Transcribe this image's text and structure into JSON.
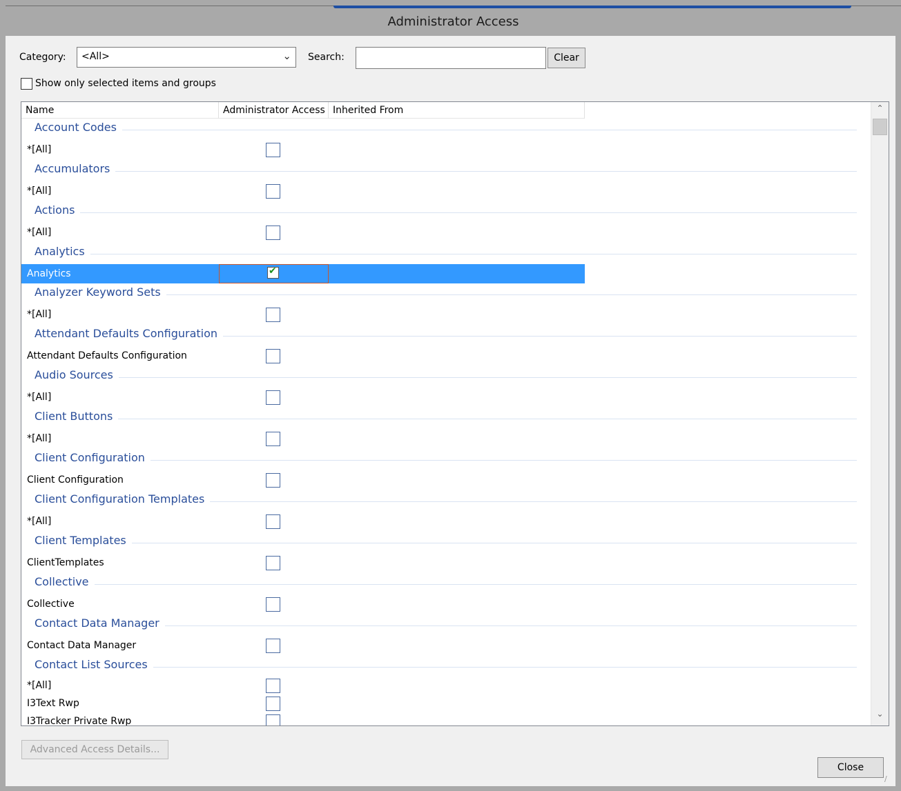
{
  "window": {
    "title": "Administrator Access"
  },
  "filters": {
    "category_label": "Category:",
    "category_value": "<All>",
    "search_label": "Search:",
    "search_value": "",
    "clear_label": "Clear",
    "show_selected_label": "Show only selected items and groups",
    "show_selected_checked": false
  },
  "columns": {
    "name": "Name",
    "admin_access": "Administrator Access",
    "inherited_from": "Inherited From"
  },
  "rows": [
    {
      "type": "group",
      "label": "Account Codes"
    },
    {
      "type": "item",
      "label": "*[All]",
      "checked": false
    },
    {
      "type": "group",
      "label": "Accumulators"
    },
    {
      "type": "item",
      "label": "*[All]",
      "checked": false
    },
    {
      "type": "group",
      "label": "Actions"
    },
    {
      "type": "item",
      "label": "*[All]",
      "checked": false
    },
    {
      "type": "group",
      "label": "Analytics"
    },
    {
      "type": "item",
      "label": "Analytics",
      "checked": true,
      "selected": true
    },
    {
      "type": "group",
      "label": "Analyzer Keyword Sets"
    },
    {
      "type": "item",
      "label": "*[All]",
      "checked": false
    },
    {
      "type": "group",
      "label": "Attendant Defaults Configuration"
    },
    {
      "type": "item",
      "label": "Attendant Defaults Configuration",
      "checked": false
    },
    {
      "type": "group",
      "label": "Audio Sources"
    },
    {
      "type": "item",
      "label": "*[All]",
      "checked": false
    },
    {
      "type": "group",
      "label": "Client Buttons"
    },
    {
      "type": "item",
      "label": "*[All]",
      "checked": false
    },
    {
      "type": "group",
      "label": "Client Configuration"
    },
    {
      "type": "item",
      "label": "Client Configuration",
      "checked": false
    },
    {
      "type": "group",
      "label": "Client Configuration Templates"
    },
    {
      "type": "item",
      "label": "*[All]",
      "checked": false
    },
    {
      "type": "group",
      "label": "Client Templates"
    },
    {
      "type": "item",
      "label": "ClientTemplates",
      "checked": false
    },
    {
      "type": "group",
      "label": "Collective"
    },
    {
      "type": "item",
      "label": "Collective",
      "checked": false
    },
    {
      "type": "group",
      "label": "Contact Data Manager"
    },
    {
      "type": "item",
      "label": "Contact Data Manager",
      "checked": false
    },
    {
      "type": "group",
      "label": "Contact List Sources"
    },
    {
      "type": "item",
      "label": "*[All]",
      "checked": false,
      "small": true
    },
    {
      "type": "item",
      "label": "I3Text Rwp",
      "checked": false,
      "small": true
    },
    {
      "type": "item",
      "label": "I3Tracker Private Rwp",
      "checked": false,
      "small": true
    }
  ],
  "footer": {
    "advanced_label": "Advanced Access Details...",
    "close_label": "Close"
  },
  "icons": {
    "dropdown": "chevron-down-icon",
    "scroll_up": "chevron-up-icon",
    "scroll_down": "chevron-down-icon",
    "check": "check-icon",
    "grip": "resize-grip-icon"
  },
  "colors": {
    "group_text": "#2a4e9a",
    "selection": "#3399ff",
    "title_accent": "#1e4fa3"
  }
}
